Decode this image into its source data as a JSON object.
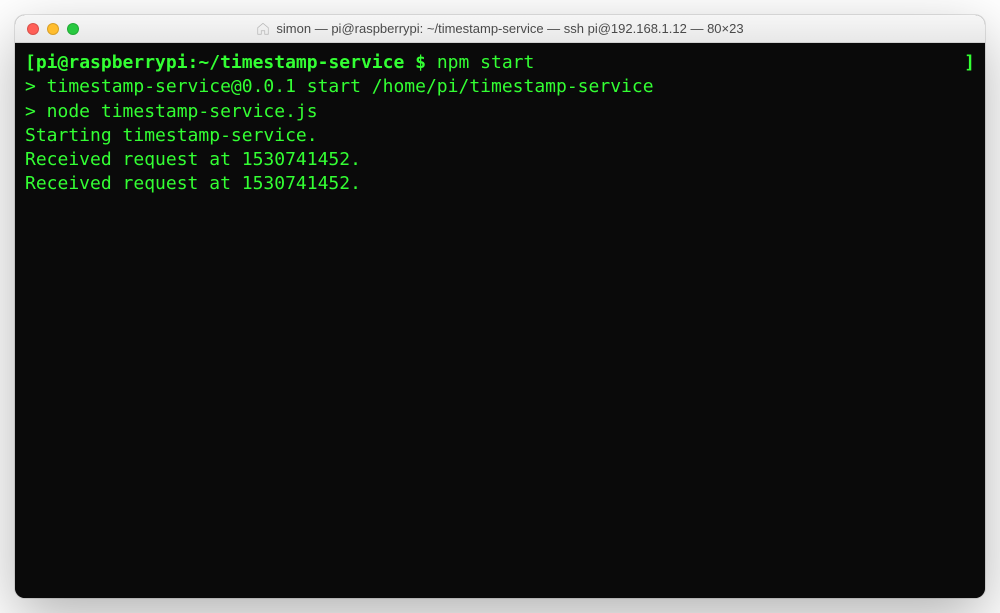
{
  "window": {
    "title": "simon — pi@raspberrypi: ~/timestamp-service — ssh pi@192.168.1.12 — 80×23"
  },
  "prompt": {
    "open_bracket": "[",
    "user_host_path": "pi@raspberrypi:~/timestamp-service $",
    "command": " npm start",
    "close_bracket": "]"
  },
  "output": {
    "lines": [
      "",
      "> timestamp-service@0.0.1 start /home/pi/timestamp-service",
      "> node timestamp-service.js",
      "",
      "Starting timestamp-service.",
      "Received request at 1530741452.",
      "Received request at 1530741452."
    ]
  }
}
